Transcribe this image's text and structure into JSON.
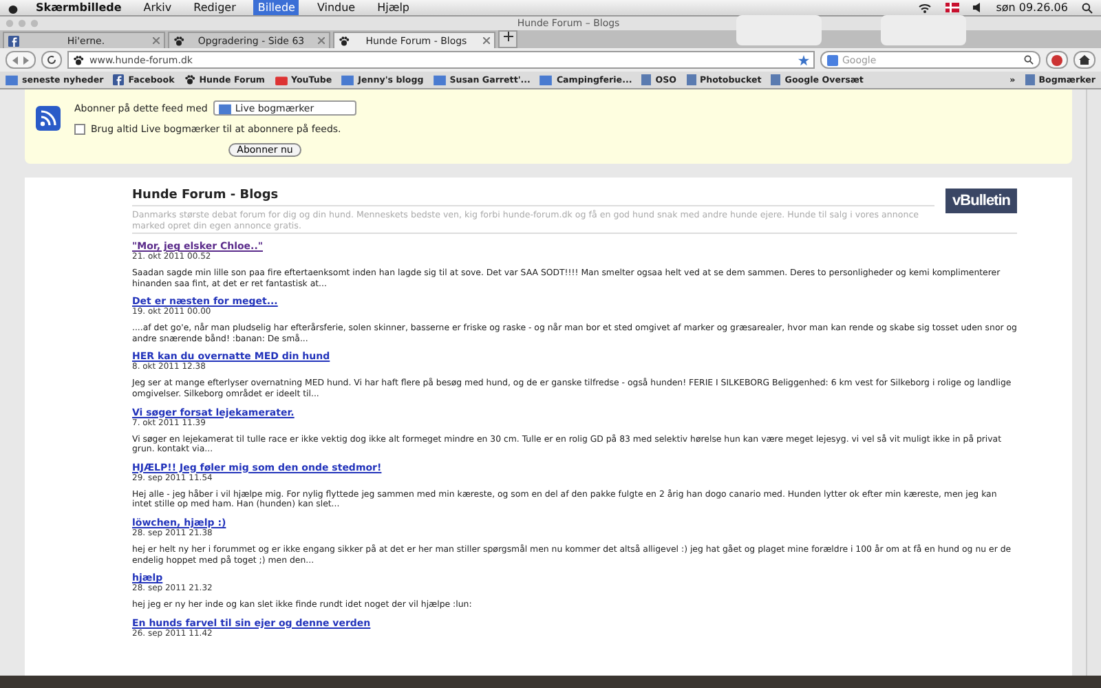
{
  "menubar": {
    "items": [
      {
        "label": "Skærmbillede",
        "selected": false
      },
      {
        "label": "Arkiv",
        "selected": false
      },
      {
        "label": "Rediger",
        "selected": false
      },
      {
        "label": "Billede",
        "selected": true
      },
      {
        "label": "Vindue",
        "selected": false
      },
      {
        "label": "Hjælp",
        "selected": false
      }
    ],
    "clock": "søn 09.26.06"
  },
  "window": {
    "title": "Hunde Forum – Blogs"
  },
  "tabs": [
    {
      "label": "Hi'erne.",
      "selected": false,
      "kind": "facebook"
    },
    {
      "label": "Opgradering - Side 63",
      "selected": false,
      "kind": "paw"
    },
    {
      "label": "Hunde Forum - Blogs",
      "selected": true,
      "kind": "paw"
    }
  ],
  "address": {
    "value": "www.hunde-forum.dk"
  },
  "search": {
    "placeholder": "Google"
  },
  "bookmarks": [
    {
      "label": "seneste nyheder",
      "kind": "folder"
    },
    {
      "label": "Facebook",
      "kind": "facebook"
    },
    {
      "label": "Hunde Forum",
      "kind": "paw"
    },
    {
      "label": "YouTube",
      "kind": "youtube"
    },
    {
      "label": "Jenny's blogg",
      "kind": "folder"
    },
    {
      "label": "Susan Garrett'...",
      "kind": "folder"
    },
    {
      "label": "Campingferie...",
      "kind": "folder"
    },
    {
      "label": "OSO",
      "kind": "page"
    },
    {
      "label": "Photobucket",
      "kind": "page"
    },
    {
      "label": "Google Oversæt",
      "kind": "page"
    }
  ],
  "bookmarks_menu": {
    "more": "»",
    "label": "Bogmærker"
  },
  "feed": {
    "label": "Abonner på dette feed med",
    "reader": "Live bogmærker",
    "always": {
      "label": "Brug altid Live bogmærker til at abonnere på feeds.",
      "checked": false
    },
    "button": "Abonner nu"
  },
  "page": {
    "title": "Hunde Forum - Blogs",
    "description": "Danmarks største debat forum for dig og din hund. Menneskets bedste ven, kig forbi hunde-forum.dk og få en god hund snak med andre hunde ejere. Hunde til salg i vores annonce marked opret din egen annonce gratis.",
    "logo": "vBulletin"
  },
  "posts": [
    {
      "title": "\"Mor, jeg elsker Chloe..\"",
      "visited": true,
      "date": "21. okt 2011 00.52",
      "excerpt": "Saadan sagde min lille son paa fire eftertaenksomt inden han lagde sig til at sove. Det var SAA SODT!!!! Man smelter ogsaa helt ved at se dem sammen. Deres to personligheder og kemi komplimenterer hinanden saa fint, at det er ret fantastisk at..."
    },
    {
      "title": "Det er næsten for meget...",
      "visited": false,
      "date": "19. okt 2011 00.00",
      "excerpt": "....af det go'e, når man pludselig har efterårsferie, solen skinner, basserne er friske og raske - og når man bor et sted omgivet af marker og græsarealer, hvor man kan rende og skabe sig tosset uden snor og andre snærende bånd! :banan: De små..."
    },
    {
      "title": "HER kan du overnatte MED din hund",
      "visited": false,
      "date": "8. okt 2011 12.38",
      "excerpt": "Jeg ser at mange efterlyser overnatning MED hund. Vi har haft flere på besøg med hund, og de er ganske tilfredse - også hunden! FERIE I SILKEBORG Beliggenhed: 6 km vest for Silkeborg i rolige og landlige omgivelser. Silkeborg området er ideelt til..."
    },
    {
      "title": "Vi søger forsat lejekamerater.",
      "visited": false,
      "date": "7. okt 2011 11.39",
      "excerpt": "Vi søger en lejekamerat til tulle race er ikke vektig dog ikke alt formeget mindre en 30 cm. Tulle er en rolig GD på 83 med selektiv hørelse hun kan være meget lejesyg. vi vel så vit muligt ikke in på privat grun. kontakt via..."
    },
    {
      "title": "HJÆLP!! Jeg føler mig som den onde stedmor!",
      "visited": false,
      "date": "29. sep 2011 11.54",
      "excerpt": "Hej alle - jeg håber i vil hjælpe mig. For nylig flyttede jeg sammen med min kæreste, og som en del af den pakke fulgte en 2 årig han dogo canario med. Hunden lytter ok efter min kæreste, men jeg kan intet stille op med ham. Han (hunden) kan slet..."
    },
    {
      "title": "löwchen, hjælp :)",
      "visited": false,
      "date": "28. sep 2011 21.38",
      "excerpt": "hej er helt ny her i forummet og er ikke engang sikker på at det er her man stiller spørgsmål men nu kommer det altså alligevel :) jeg hat gået og plaget mine forældre i 100 år om at få en hund og nu er de endelig hoppet med på toget ;) men den..."
    },
    {
      "title": "hjælp",
      "visited": false,
      "date": "28. sep 2011 21.32",
      "excerpt": "hej jeg er ny her inde og kan slet ikke finde rundt idet noget der vil hjælpe :lun:"
    },
    {
      "title": "En hunds farvel til sin ejer og denne verden",
      "visited": false,
      "date": "26. sep 2011 11.42"
    }
  ]
}
